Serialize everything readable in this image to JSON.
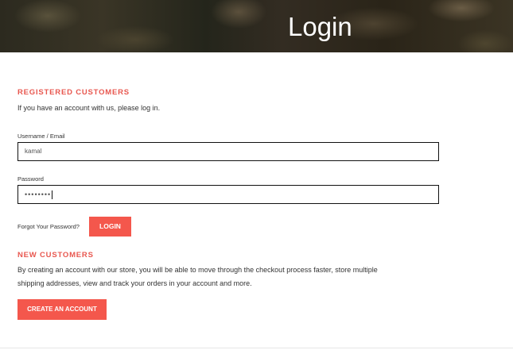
{
  "header": {
    "title": "Login"
  },
  "registered": {
    "heading": "REGISTERED CUSTOMERS",
    "intro": "If you have an account with us, please log in.",
    "username_label": "Username / Email",
    "username_value": "kamal",
    "password_label": "Password",
    "password_value": "••••••••",
    "forgot_label": "Forgot Your Password?",
    "login_button": "LOGIN"
  },
  "new_customers": {
    "heading": "NEW CUSTOMERS",
    "description_line1": "By creating an account with our store, you will be able to move through the checkout process faster, store multiple",
    "description_line2": "shipping addresses, view and track your orders in your account and more.",
    "create_button": "CREATE AN ACCOUNT"
  },
  "colors": {
    "accent": "#f4574c",
    "heading": "#e8574f"
  }
}
